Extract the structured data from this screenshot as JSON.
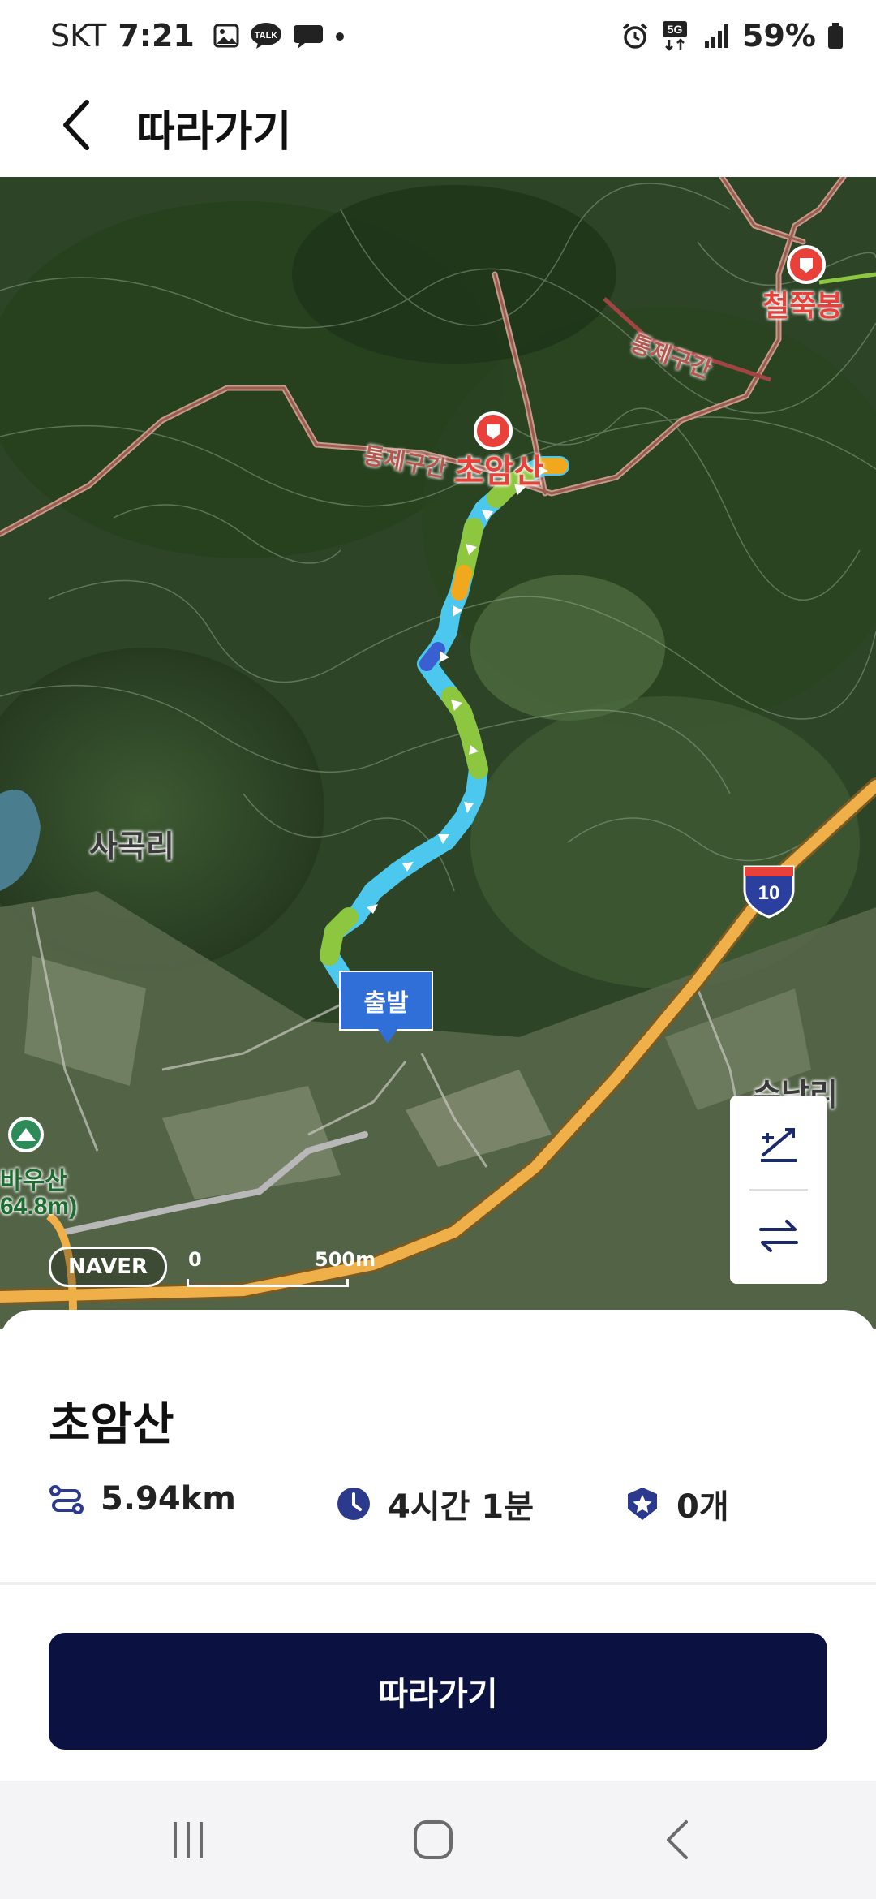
{
  "status_bar": {
    "carrier": "SKT",
    "time": "7:21",
    "notification_icons": [
      "gallery-icon",
      "kakaotalk-icon",
      "chat-bubble-icon",
      "dot-icon"
    ],
    "talk_badge": "TALK",
    "network_badge": "5G",
    "battery": "59%"
  },
  "header": {
    "title": "따라가기",
    "back_icon": "chevron-left-icon"
  },
  "map": {
    "peak_name": "초암산",
    "peak_name_2": "철쭉봉",
    "peak_name_3": "바우산",
    "peak_elevation_3": "64.8m)",
    "zone_label": "통제구간",
    "zone_label_2": "통제구간",
    "village_label": "사곡리",
    "village_label_2": "수남리",
    "highway_shield": "10",
    "start_marker": "출발",
    "provider": "NAVER",
    "scale_zero": "0",
    "scale_distance": "500m",
    "controls": [
      "elevation-chart-icon",
      "swap-direction-icon"
    ],
    "route_colors": {
      "fast": "#4cc8ef",
      "medium": "#8dc63f",
      "slow": "#f2a81d"
    }
  },
  "course": {
    "name": "초암산",
    "distance": "5.94km",
    "duration": "4시간 1분",
    "badges": "0개"
  },
  "actions": {
    "follow_label": "따라가기"
  },
  "colors": {
    "primary": "#0b1140",
    "stat_icon": "#2b3a8c"
  },
  "nav_bar": {
    "buttons": [
      "recent-apps-icon",
      "home-icon",
      "back-icon"
    ]
  }
}
